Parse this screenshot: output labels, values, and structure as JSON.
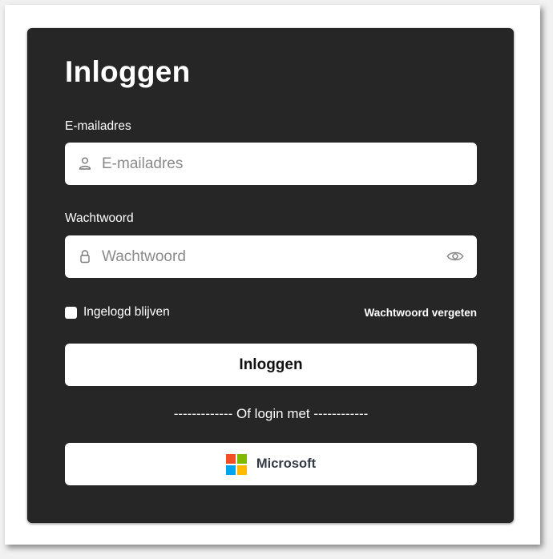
{
  "login": {
    "title": "Inloggen",
    "email": {
      "label": "E-mailadres",
      "placeholder": "E-mailadres",
      "value": ""
    },
    "password": {
      "label": "Wachtwoord",
      "placeholder": "Wachtwoord",
      "value": ""
    },
    "remember_label": "Ingelogd blijven",
    "remember_checked": false,
    "forgot_label": "Wachtwoord vergeten",
    "submit_label": "Inloggen",
    "divider_text": "------------- Of login met ------------",
    "microsoft_label": "Microsoft"
  },
  "icons": {
    "email_field": "user-icon",
    "password_field": "lock-icon",
    "password_toggle": "eye-icon",
    "provider": "microsoft-logo-icon"
  },
  "colors": {
    "card_background": "#262626",
    "microsoft_red": "#f25022",
    "microsoft_green": "#7fba00",
    "microsoft_blue": "#00a4ef",
    "microsoft_yellow": "#ffb900"
  }
}
